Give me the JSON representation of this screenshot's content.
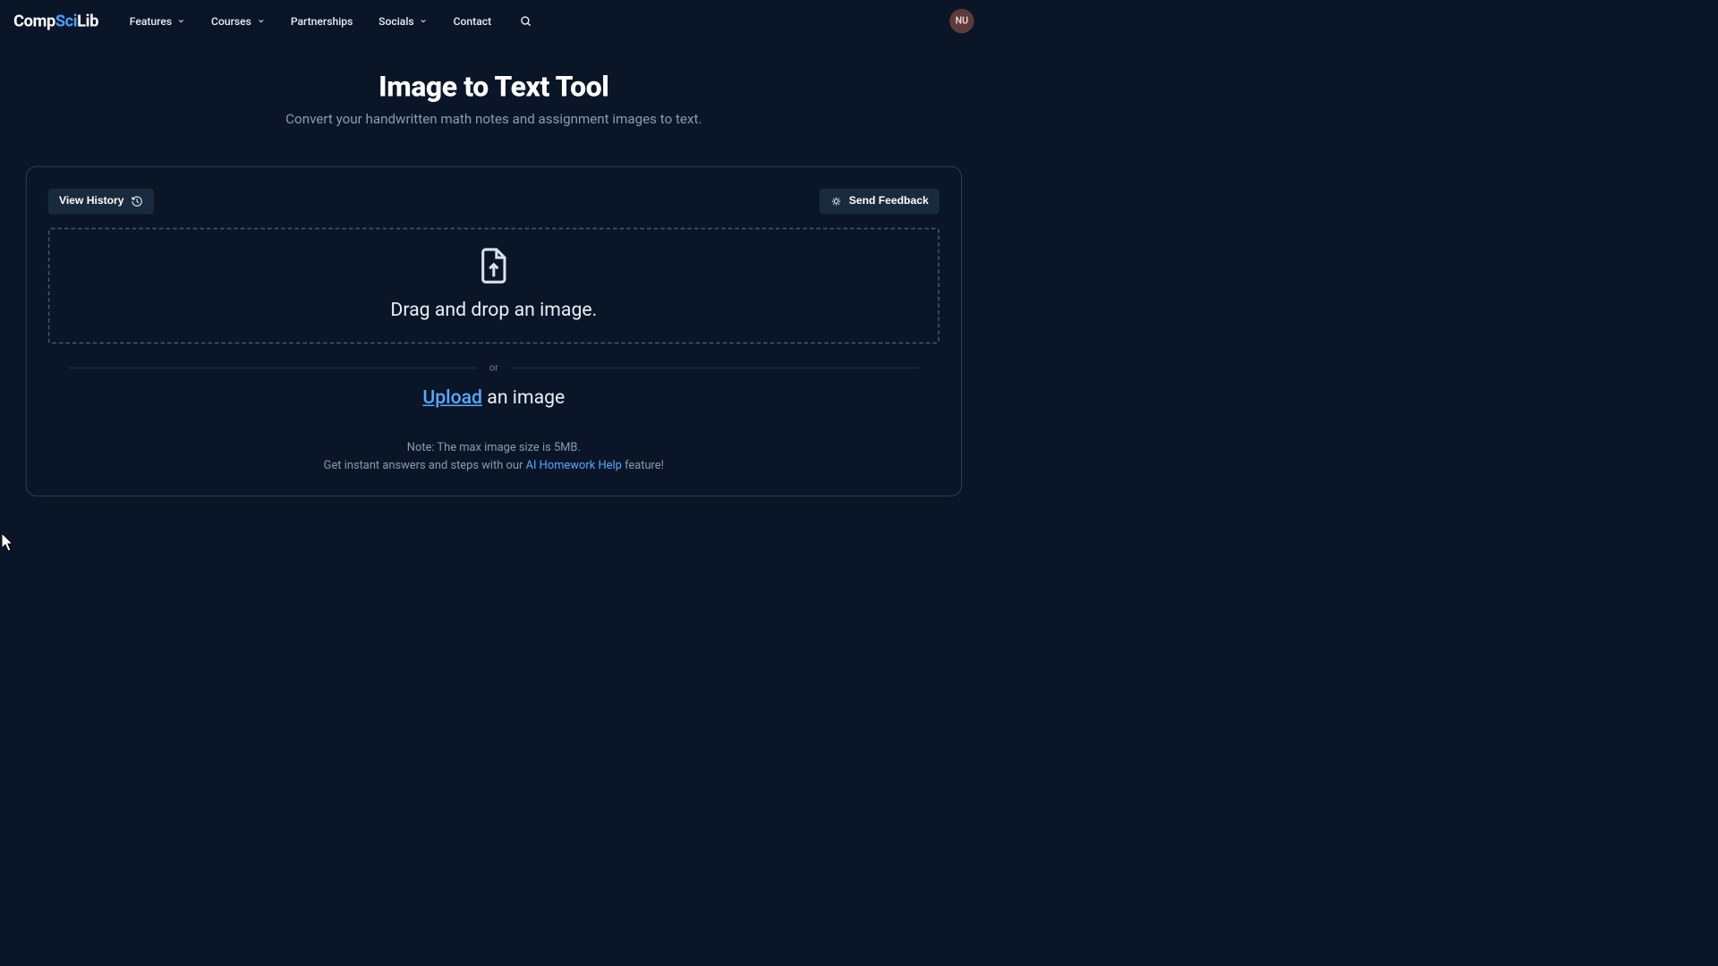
{
  "logo": {
    "part1": "Comp",
    "part2": "Sci",
    "part3": "Lib"
  },
  "nav": {
    "features": "Features",
    "courses": "Courses",
    "partnerships": "Partnerships",
    "socials": "Socials",
    "contact": "Contact"
  },
  "avatar_initials": "NU",
  "page": {
    "title": "Image to Text Tool",
    "subtitle": "Convert your handwritten math notes and assignment images to text."
  },
  "card": {
    "view_history": "View History",
    "send_feedback": "Send Feedback",
    "drop_text": "Drag and drop an image.",
    "divider": "or",
    "upload_link": "Upload",
    "upload_rest": " an image",
    "note_line1": "Note: The max image size is 5MB.",
    "note_line2_a": "Get instant answers and steps with our ",
    "note_line2_link": "AI Homework Help",
    "note_line2_b": " feature!"
  }
}
